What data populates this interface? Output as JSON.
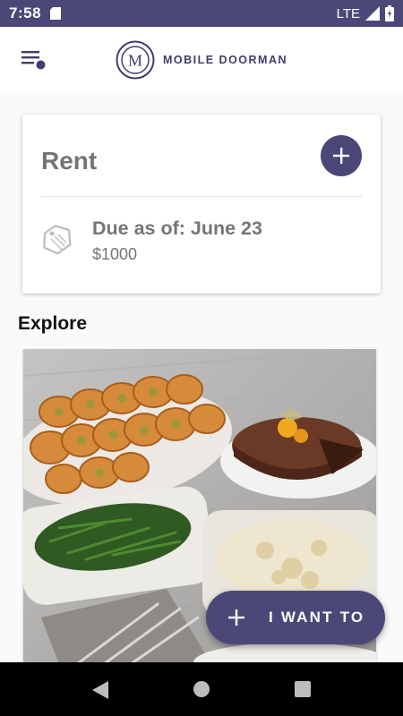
{
  "status_bar": {
    "time": "7:58",
    "network": "LTE"
  },
  "header": {
    "logo_letter": "M",
    "app_name": "MOBILE DOORMAN"
  },
  "rent_card": {
    "title": "Rent",
    "due_label": "Due as of: June 23",
    "amount": "$1000"
  },
  "explore": {
    "title": "Explore"
  },
  "fab": {
    "label": "I WANT TO"
  },
  "colors": {
    "primary": "#4b4878",
    "text_gray": "#757575"
  },
  "icons": {
    "menu": "menu-icon",
    "add": "plus-icon",
    "tag": "price-tag-icon",
    "back": "back-icon",
    "home": "home-icon",
    "recents": "recents-icon"
  }
}
